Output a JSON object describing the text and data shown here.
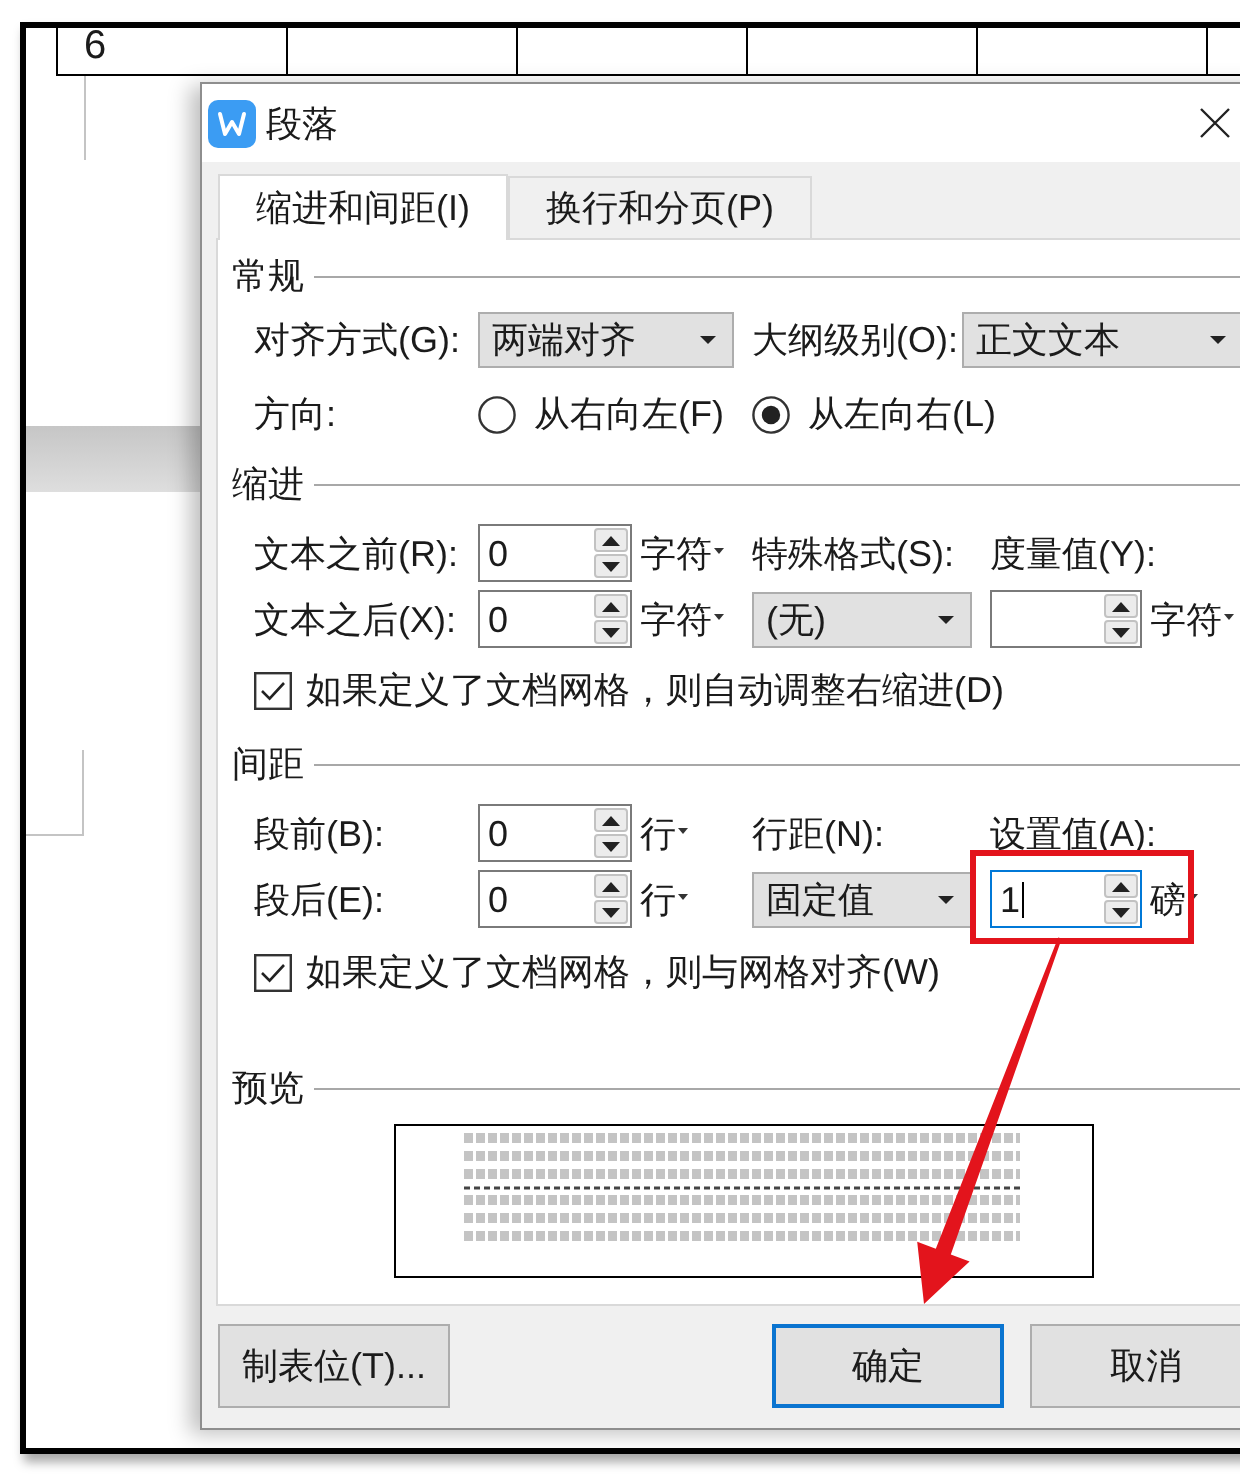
{
  "document": {
    "table_row": {
      "first_cell": "6"
    }
  },
  "dialog": {
    "title": "段落",
    "tabs": [
      {
        "label": "缩进和间距(I)",
        "selected": true
      },
      {
        "label": "换行和分页(P)",
        "selected": false
      }
    ],
    "general": {
      "title": "常规",
      "alignment": {
        "label": "对齐方式(G):",
        "value": "两端对齐"
      },
      "outline_level": {
        "label": "大纲级别(O):",
        "value": "正文文本"
      },
      "direction": {
        "label": "方向:",
        "options": [
          {
            "label": "从右向左(F)",
            "selected": false
          },
          {
            "label": "从左向右(L)",
            "selected": true
          }
        ]
      }
    },
    "indentation": {
      "title": "缩进",
      "before_text": {
        "label": "文本之前(R):",
        "value": "0",
        "unit": "字符"
      },
      "after_text": {
        "label": "文本之后(X):",
        "value": "0",
        "unit": "字符"
      },
      "special": {
        "label": "特殊格式(S):",
        "value": "(无)"
      },
      "by": {
        "label": "度量值(Y):",
        "unit": "字符"
      },
      "auto_adjust_right": {
        "label": "如果定义了文档网格，则自动调整右缩进(D)",
        "checked": true
      }
    },
    "spacing": {
      "title": "间距",
      "before": {
        "label": "段前(B):",
        "value": "0",
        "unit": "行"
      },
      "after": {
        "label": "段后(E):",
        "value": "0",
        "unit": "行"
      },
      "line_spacing": {
        "label": "行距(N):",
        "value": "固定值"
      },
      "at": {
        "label": "设置值(A):",
        "value": "1",
        "unit": "磅",
        "focused": true
      },
      "snap_to_grid": {
        "label": "如果定义了文档网格，则与网格对齐(W)",
        "checked": true
      }
    },
    "preview": {
      "title": "预览"
    },
    "buttons": {
      "left": [
        {
          "label": "制表位(T)...",
          "default": false
        }
      ],
      "right": [
        {
          "label": "确定",
          "default": true
        },
        {
          "label": "取消",
          "default": false
        }
      ]
    }
  }
}
